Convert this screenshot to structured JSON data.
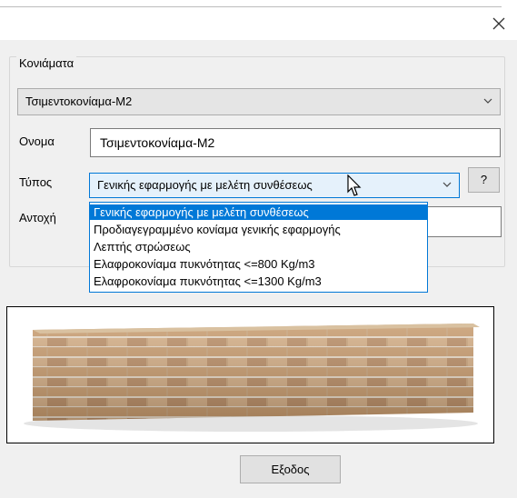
{
  "window": {
    "close_label": "×"
  },
  "group": {
    "label": "Κονιάματα"
  },
  "mortar_select": {
    "value": "Τσιμεντοκονίαμα-M2"
  },
  "name_field": {
    "label": "Ονομα",
    "value": "Τσιμεντοκονίαμα-M2"
  },
  "type_field": {
    "label": "Τύπος",
    "value": "Γενικής εφαρμογής με μελέτη συνθέσεως",
    "help_label": "?",
    "options": [
      "Γενικής εφαρμογής με μελέτη συνθέσεως",
      "Προδιαγεγραμμένο κονίαμα γενικής εφαρμογής",
      "Λεπτής στρώσεως",
      "Ελαφροκονίαμα πυκνότητας <=800 Kg/m3",
      "Ελαφροκονίαμα πυκνότητας <=1300 Kg/m3"
    ],
    "selected_index": 0
  },
  "strength_field": {
    "label": "Αντοχή"
  },
  "footer": {
    "exit_label": "Εξοδος"
  },
  "icons": [
    "close-icon",
    "chevron-down-icon",
    "mouse-cursor-icon"
  ],
  "colors": {
    "accent": "#0078d7",
    "dialog_bg": "#f0f0f0"
  }
}
